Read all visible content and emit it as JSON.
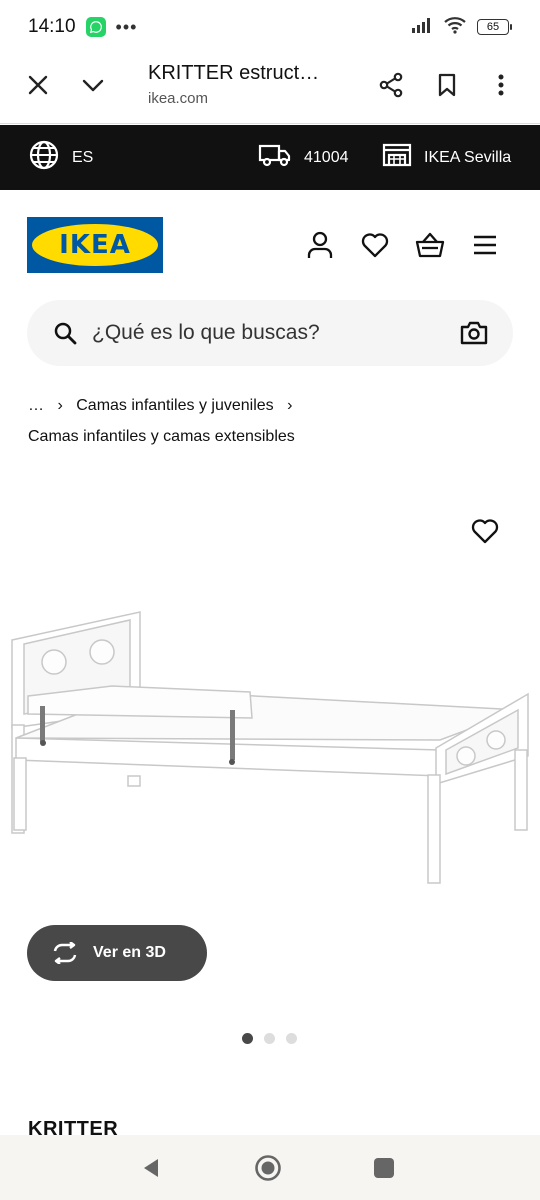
{
  "status_bar": {
    "time": "14:10",
    "more": "•••",
    "battery": "65"
  },
  "browser": {
    "page_title": "KRITTER estruct…",
    "domain": "ikea.com"
  },
  "top_strip": {
    "language": "ES",
    "postal_code": "41004",
    "store": "IKEA Sevilla"
  },
  "header": {
    "logo_text": "IKEA"
  },
  "search": {
    "placeholder": "¿Qué es lo que buscas?"
  },
  "breadcrumb": {
    "ellipsis": "…",
    "separator": "›",
    "level1": "Camas infantiles y juveniles",
    "current": "Camas infantiles y camas extensibles"
  },
  "gallery": {
    "view_3d_label": "Ver en 3D",
    "dots_total": 3,
    "active_dot": 0
  },
  "product": {
    "name": "KRITTER"
  },
  "icons": {
    "close": "close-icon",
    "chevron": "chevron-down-icon",
    "share": "share-icon",
    "bookmark": "bookmark-icon",
    "menu": "more-vertical-icon",
    "globe": "globe-icon",
    "truck": "truck-icon",
    "store": "store-icon",
    "account": "account-icon",
    "heart": "heart-icon",
    "basket": "basket-icon",
    "hamburger": "hamburger-icon",
    "search": "search-icon",
    "camera": "camera-icon",
    "rotate": "rotate-3d-icon"
  },
  "colors": {
    "ikea_blue": "#0058A3",
    "ikea_yellow": "#FFDB00",
    "strip_bg": "#111111",
    "button_dark": "#484848",
    "search_bg": "#f5f5f5"
  }
}
